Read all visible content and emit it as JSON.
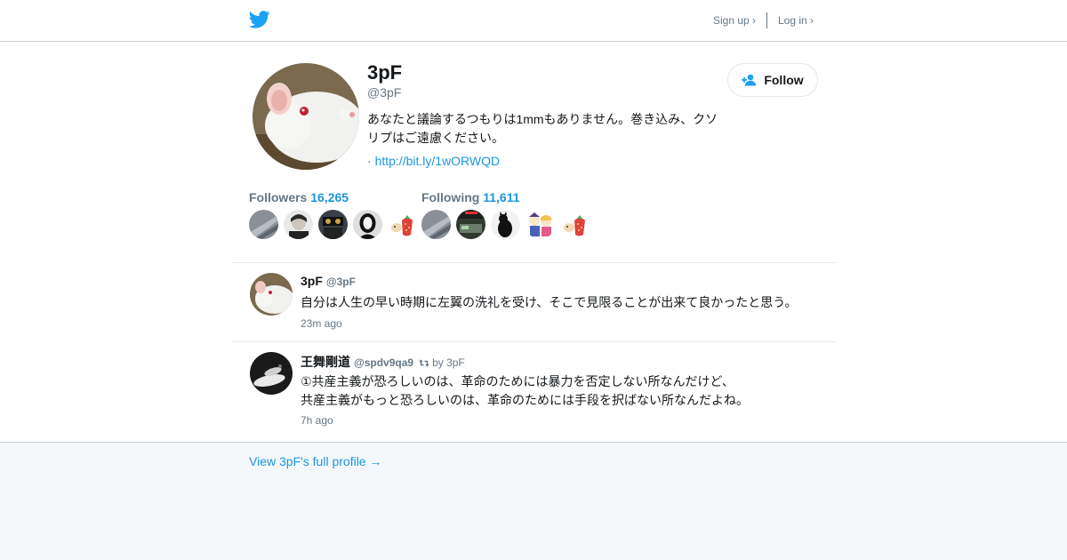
{
  "topbar": {
    "logo_icon": "twitter-bird-icon",
    "signup_label": "Sign up ›",
    "login_label": "Log in ›"
  },
  "profile": {
    "name": "3pF",
    "handle": "@3pF",
    "bio": "あなたと議論するつもりは1mmもありません。巻き込み、クソリプはご遠慮ください。",
    "url_prefix": "·",
    "url": "http://bit.ly/1wORWQD",
    "follow_label": "Follow",
    "follow_icon": "add-user-icon"
  },
  "stats": {
    "followers_label": "Followers",
    "followers_count": "16,265",
    "following_label": "Following",
    "following_count": "11,611"
  },
  "tweets": [
    {
      "name": "3pF",
      "handle": "@3pF",
      "text": "自分は人生の早い時期に左翼の洗礼を受け、そこで見限ることが出来て良かったと思う。",
      "time": "23m ago"
    },
    {
      "name": "王舞剛道",
      "handle": "@spdv9qa9",
      "retweet_icon": "retweet-icon",
      "retweet_by": "by 3pF",
      "text_line1": "①共産主義が恐ろしいのは、革命のためには暴力を否定しない所なんだけど、",
      "text_line2": "共産主義がもっと恐ろしいのは、革命のためには手段を択ばない所なんだよね。",
      "time": "7h ago"
    }
  ],
  "footer": {
    "full_profile_label": "View 3pF's full profile →"
  },
  "colors": {
    "accent": "#1b95e0",
    "twitter_blue": "#1da1f2",
    "muted": "#657786",
    "background": "#f5f8fa"
  }
}
